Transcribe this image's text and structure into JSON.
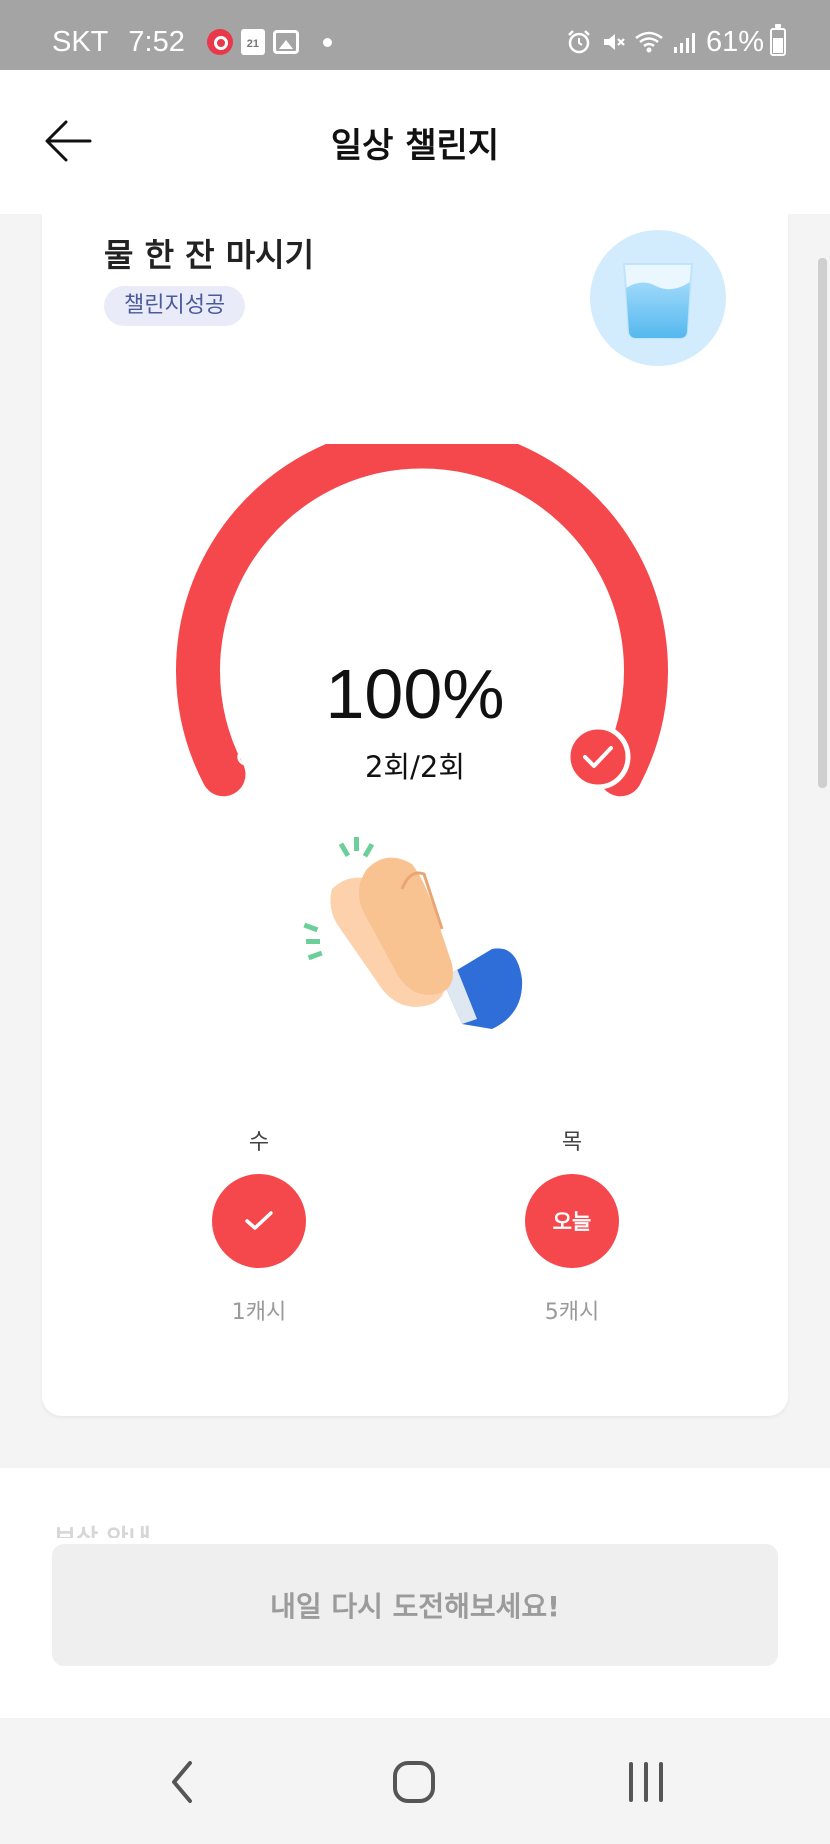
{
  "status_bar": {
    "carrier": "SKT",
    "time": "7:52",
    "calendar_day": "21",
    "battery": "61%"
  },
  "header": {
    "title": "일상 챌린지",
    "back_icon": "arrow-left-icon"
  },
  "challenge": {
    "title": "물 한 잔 마시기",
    "badge": "챌린지성공",
    "icon": "water-glass-icon",
    "progress": {
      "percent_text": "100%",
      "count_text": "2회/2회",
      "fraction": 1.0
    }
  },
  "days": [
    {
      "label": "수",
      "reward": "1캐시",
      "state": "done",
      "icon": "check-icon"
    },
    {
      "label": "목",
      "reward": "5캐시",
      "state": "today",
      "text": "오늘"
    }
  ],
  "reward": {
    "heading": "보상 안내",
    "button": "내일 다시 도전해보세요!"
  },
  "colors": {
    "accent": "#f5484d",
    "badge_bg": "#e9ecf8",
    "badge_text": "#4a5a9b"
  }
}
